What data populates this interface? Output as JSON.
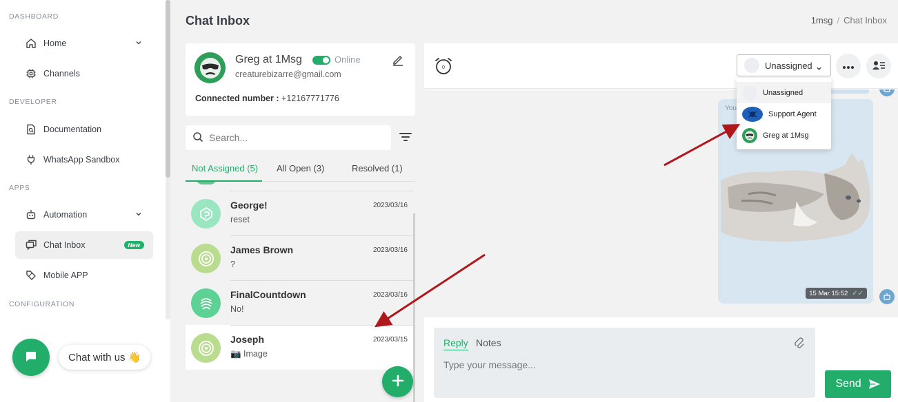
{
  "sidebar": {
    "sections": {
      "dashboard": "DASHBOARD",
      "developer": "DEVELOPER",
      "apps": "APPS",
      "configuration": "CONFIGURATION"
    },
    "items": {
      "home": "Home",
      "channels": "Channels",
      "documentation": "Documentation",
      "whatsapp_sandbox": "WhatsApp Sandbox",
      "automation": "Automation",
      "chat_inbox": "Chat Inbox",
      "chat_inbox_badge": "New",
      "mobile_app": "Mobile APP"
    },
    "chat_widget": "Chat with us 👋"
  },
  "header": {
    "title": "Chat Inbox",
    "breadcrumb": [
      "1msg",
      "Chat Inbox"
    ]
  },
  "profile": {
    "name": "Greg at 1Msg",
    "status": "Online",
    "email": "creaturebizarre@gmail.com",
    "connected_label": "Connected number :",
    "connected_number": "+12167771776"
  },
  "search": {
    "placeholder": "Search..."
  },
  "tabs": [
    {
      "label": "Not Assigned (5)",
      "active": true
    },
    {
      "label": "All Open (3)",
      "active": false
    },
    {
      "label": "Resolved (1)",
      "active": false
    }
  ],
  "conversations": [
    {
      "name": "George!",
      "message": "reset",
      "date": "2023/03/16",
      "avatar_color": "#8fe0b6"
    },
    {
      "name": "James Brown",
      "message": "?",
      "date": "2023/03/16",
      "avatar_color": "#b2d98a"
    },
    {
      "name": "FinalCountdown",
      "message": "No!",
      "date": "2023/03/16",
      "avatar_color": "#4fcf8a"
    },
    {
      "name": "Joseph",
      "message": "📷 Image",
      "date": "2023/03/15",
      "avatar_color": "#b2d98a"
    }
  ],
  "chat": {
    "assignee": "Unassigned",
    "assign_options": [
      "Unassigned",
      "Support Agent",
      "Greg at 1Msg"
    ],
    "message_sender": "You",
    "message_time": "15 Mar 15:52",
    "message_ticks": "✓✓"
  },
  "reply": {
    "tabs": [
      "Reply",
      "Notes"
    ],
    "placeholder": "Type your message...",
    "send_label": "Send"
  },
  "colors": {
    "accent": "#22ae6a",
    "arrow": "#b0171b"
  }
}
